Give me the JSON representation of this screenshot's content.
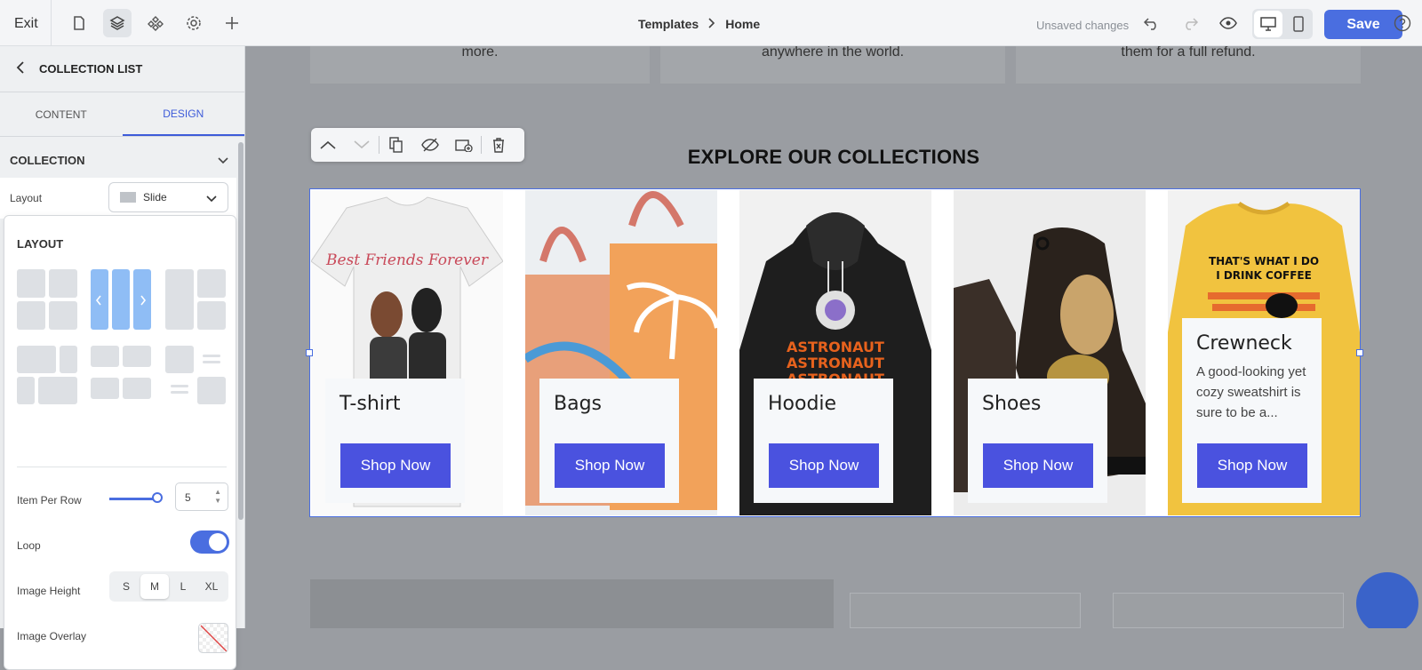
{
  "topbar": {
    "exit_label": "Exit",
    "breadcrumb": [
      "Templates",
      "Home"
    ],
    "unsaved": "Unsaved changes",
    "save_label": "Save"
  },
  "sidebar": {
    "title": "COLLECTION LIST",
    "tabs": [
      "CONTENT",
      "DESIGN"
    ],
    "section": "COLLECTION",
    "layout_label": "Layout",
    "layout_value": "Slide",
    "panel_title": "LAYOUT",
    "item_per_row_label": "Item Per Row",
    "item_per_row_value": "5",
    "item_per_row_fraction": 1.0,
    "loop_label": "Loop",
    "loop_on": true,
    "image_height_label": "Image Height",
    "image_height_options": [
      "S",
      "M",
      "L",
      "XL"
    ],
    "image_height_selected": "M",
    "image_overlay_label": "Image Overlay"
  },
  "canvas": {
    "features": [
      "more.",
      "anywhere in the world.",
      "them for a full refund."
    ],
    "heading": "EXPLORE OUR COLLECTIONS",
    "collections": [
      {
        "title": "T-shirt",
        "button": "Shop Now"
      },
      {
        "title": "Bags",
        "button": "Shop Now"
      },
      {
        "title": "Hoodie",
        "button": "Shop Now"
      },
      {
        "title": "Shoes",
        "button": "Shop Now"
      },
      {
        "title": "Crewneck",
        "description": "A good-looking yet cozy sweatshirt is sure to be a...",
        "button": "Shop Now"
      }
    ],
    "tshirt_print": "Best Friends Forever",
    "hoodie_print": [
      "ASTRONAUT",
      "ASTRONAUT",
      "ASTRONAUT"
    ],
    "crewneck_print": [
      "THAT'S WHAT I DO",
      "I DRINK COFFEE"
    ]
  },
  "colors": {
    "accent": "#4a6ee0",
    "button": "#4a52df"
  }
}
